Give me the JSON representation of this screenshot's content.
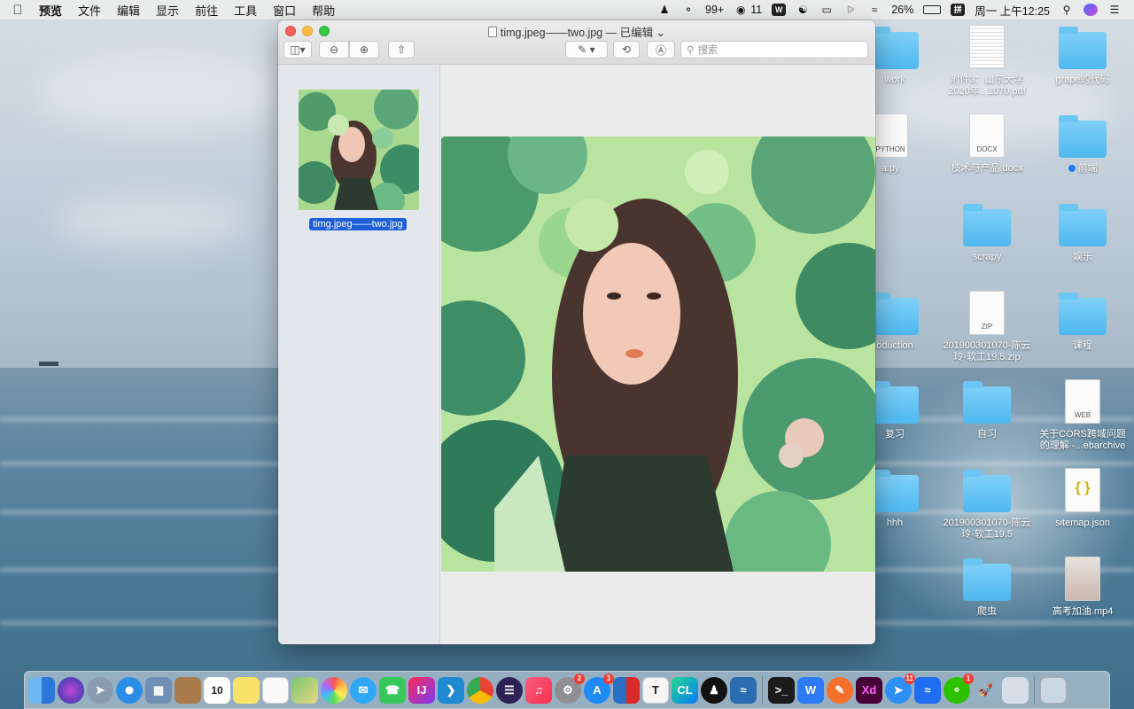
{
  "menubar": {
    "app_name": "预览",
    "items": [
      "文件",
      "编辑",
      "显示",
      "前往",
      "工具",
      "窗口",
      "帮助"
    ],
    "wechat_count": "99+",
    "app_badge_count": "11",
    "battery": "26%",
    "input_method": "拼",
    "datetime": "周一 上午12:25"
  },
  "window": {
    "title": "timg.jpeg——two.jpg",
    "edited_suffix": "— 已编辑",
    "search_placeholder": "搜索",
    "thumbnail_label": "timg.jpeg——two.jpg"
  },
  "desktop_icons": [
    {
      "label": "work",
      "kind": "folder"
    },
    {
      "label": "附件3：山东大学 2020年...1070.pdf",
      "kind": "pdf"
    },
    {
      "label": "grape的代码",
      "kind": "folder"
    },
    {
      "label": "a.py",
      "kind": "python",
      "badge": "PYTHON"
    },
    {
      "label": "技术与产品.docx",
      "kind": "docx",
      "badge": "DOCX"
    },
    {
      "label": "前端",
      "kind": "folder"
    },
    {
      "label": "scrapy",
      "kind": "folder"
    },
    {
      "label": "娱乐",
      "kind": "folder"
    },
    {
      "label": "oduction",
      "kind": "folder"
    },
    {
      "label": "201900301070-陈云玲-软工19.5.zip",
      "kind": "zip",
      "badge": "ZIP"
    },
    {
      "label": "课程",
      "kind": "folder"
    },
    {
      "label": "复习",
      "kind": "folder"
    },
    {
      "label": "自习",
      "kind": "folder"
    },
    {
      "label": "关于CORS跨域问题的理解 -...ebarchive",
      "kind": "web",
      "badge": "WEB"
    },
    {
      "label": "hhh",
      "kind": "folder"
    },
    {
      "label": "201900301070-陈云玲-软工19.5",
      "kind": "folder"
    },
    {
      "label": "sitemap.json",
      "kind": "json",
      "badge": "{ }"
    },
    {
      "label": "爬虫",
      "kind": "folder"
    },
    {
      "label": "高考加油.mp4",
      "kind": "video"
    }
  ],
  "dock": {
    "calendar_day": "10",
    "badges": {
      "system_prefs": "2",
      "app_store": "3",
      "wechat": "1",
      "feishu": "11"
    },
    "apps": [
      "finder",
      "siri",
      "launchpad",
      "safari",
      "preview",
      "notes-book",
      "calendar",
      "stickies",
      "reminders",
      "maps",
      "photos",
      "messages",
      "facetime",
      "intellij",
      "vscode",
      "chrome",
      "eclipse",
      "music",
      "system-preferences",
      "app-store",
      "parallels",
      "typora",
      "clion",
      "qq",
      "wireshark",
      "terminal",
      "wps",
      "sketch",
      "xd",
      "feishu",
      "lark",
      "wechat",
      "rocket",
      "preview-2",
      "trash"
    ]
  },
  "colors": {
    "selection": "#1d5fd8",
    "folder": "#4fb8ef",
    "close": "#fc605c",
    "minimize": "#fdbc40",
    "maximize": "#34c84a"
  }
}
